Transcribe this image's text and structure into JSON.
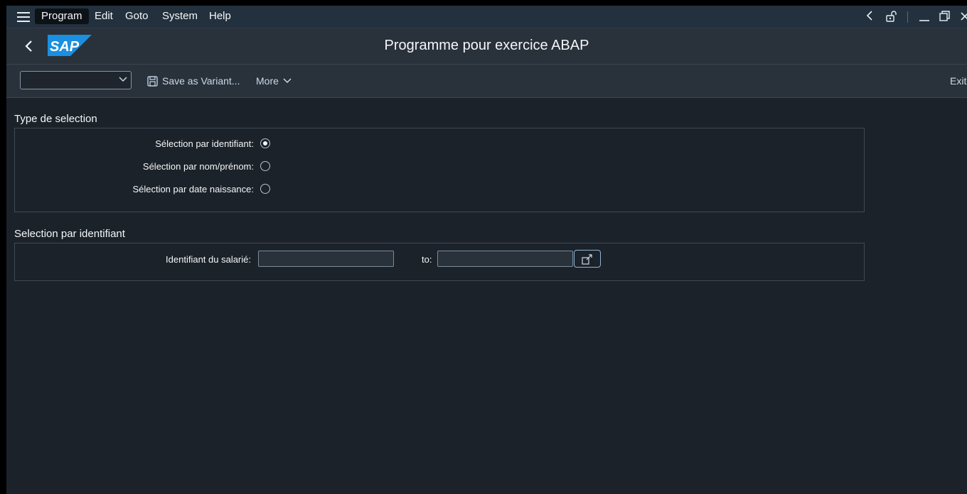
{
  "menubar": {
    "items": [
      "Program",
      "Edit",
      "Goto",
      "System",
      "Help"
    ]
  },
  "header": {
    "title": "Programme pour exercice ABAP",
    "logo_text": "SAP"
  },
  "toolbar": {
    "variant_value": "",
    "save_variant_label": "Save as Variant...",
    "more_label": "More",
    "exit_label": "Exit"
  },
  "selection_type": {
    "title": "Type de selection",
    "options": [
      {
        "label": "Sélection par identifiant:",
        "selected": true
      },
      {
        "label": "Sélection par nom/prénom:",
        "selected": false
      },
      {
        "label": "Sélection par date naissance:",
        "selected": false
      }
    ]
  },
  "selection_id": {
    "title": "Selection par identifiant",
    "field_label": "Identifiant du salarié:",
    "from_value": "",
    "to_label": "to:",
    "to_value": ""
  },
  "colors": {
    "background": "#1c2229",
    "menubar": "#23303d",
    "header": "#29313a",
    "accent": "#8fb4d8",
    "logo_blue": "#1b8fe0"
  },
  "icons": {
    "menu": "hamburger-icon",
    "back": "chevron-left-icon",
    "save": "floppy-disk-icon",
    "more": "chevron-down-icon",
    "multiple_selection": "multiple-selection-icon",
    "window_back": "chevron-left-icon",
    "lock": "unlock-icon",
    "minimize": "minimize-icon",
    "maximize": "maximize-icon",
    "close": "close-icon"
  }
}
